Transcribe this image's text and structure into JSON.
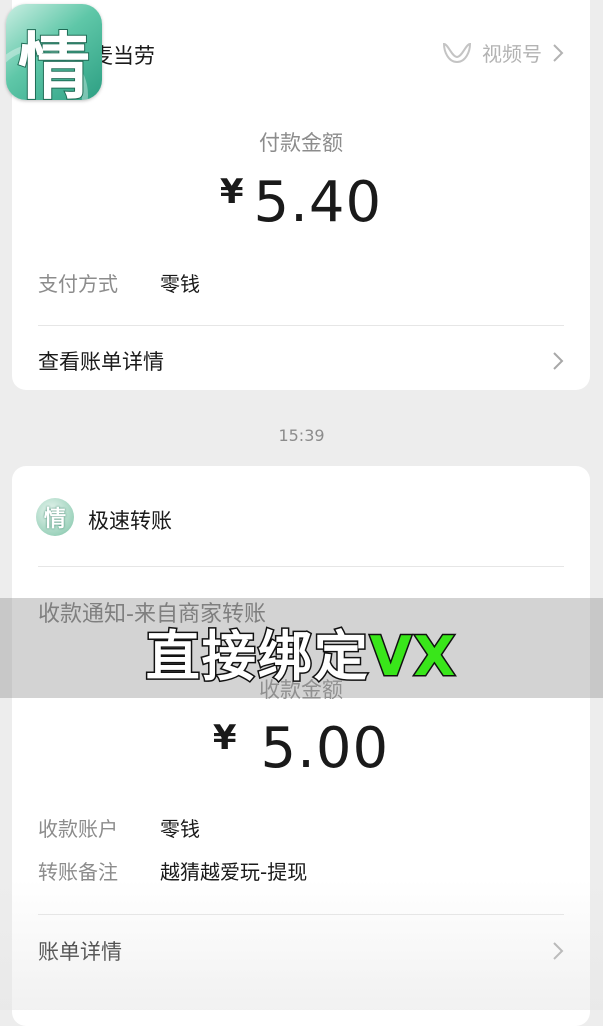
{
  "payment_card": {
    "merchant_name": "麦当劳",
    "channel_label": "视频号",
    "amount_label": "付款金额",
    "currency_symbol": "¥",
    "amount": "5.40",
    "pay_method_label": "支付方式",
    "pay_method_value": "零钱",
    "view_bill_label": "查看账单详情"
  },
  "timestamp": "15:39",
  "transfer_card": {
    "business_name": "极速转账",
    "business_logo_char": "情",
    "notice_title": "收款通知-来自商家转账",
    "amount_label": "收款金额",
    "currency_symbol": "¥",
    "amount": "5.00",
    "account_label": "收款账户",
    "account_value": "零钱",
    "remark_label": "转账备注",
    "remark_value": "越猜越爱玩-提现",
    "bill_detail_label": "账单详情"
  },
  "overlay_caption": {
    "white_part": "直接绑定",
    "green_part": "VX",
    "colors": {
      "white": "#ffffff",
      "green": "#39e61a"
    }
  },
  "app_logo": {
    "char": "情",
    "icon": "app-logo-icon"
  }
}
